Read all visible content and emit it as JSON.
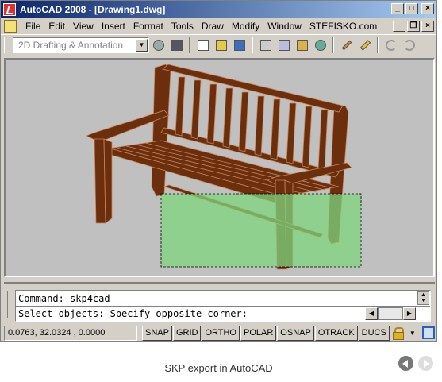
{
  "window": {
    "title": "AutoCAD 2008 - [Drawing1.dwg]",
    "minimize": "_",
    "maximize": "□",
    "close": "×"
  },
  "menu": {
    "items": [
      "File",
      "Edit",
      "View",
      "Insert",
      "Format",
      "Tools",
      "Draw",
      "Modify",
      "Window",
      "STEFISKO.com"
    ],
    "doc_minimize": "_",
    "doc_restore": "❐",
    "doc_close": "×"
  },
  "toolbar": {
    "workspace_value": "2D Drafting & Annotation",
    "workspace_arrow": "▼",
    "icons": [
      "workspace-settings-icon",
      "my-workspace-icon",
      "new-file-icon",
      "open-file-icon",
      "save-icon",
      "plot-icon",
      "plot-preview-icon",
      "publish-icon",
      "3d-dwf-icon",
      "cut-icon",
      "matchprop-icon",
      "undo-icon",
      "redo-icon"
    ]
  },
  "drawing": {
    "wood_color": "#6b2f0e",
    "edge_color": "#c8845a",
    "selection_fill": "#7fd67f",
    "background": "#c0c0c0"
  },
  "command": {
    "line1": "Command: skp4cad",
    "line2": "Select objects: Specify opposite corner:",
    "scroll_up": "▲",
    "scroll_down": "▼",
    "scroll_left": "◀",
    "scroll_right": "▶"
  },
  "status": {
    "coordinates": "0.0763,  32.0324 , 0.0000",
    "toggles": [
      "SNAP",
      "GRID",
      "ORTHO",
      "POLAR",
      "OSNAP",
      "OTRACK",
      "DUCS"
    ],
    "menu_arrow": "▼"
  },
  "caption": "SKP export in AutoCAD"
}
